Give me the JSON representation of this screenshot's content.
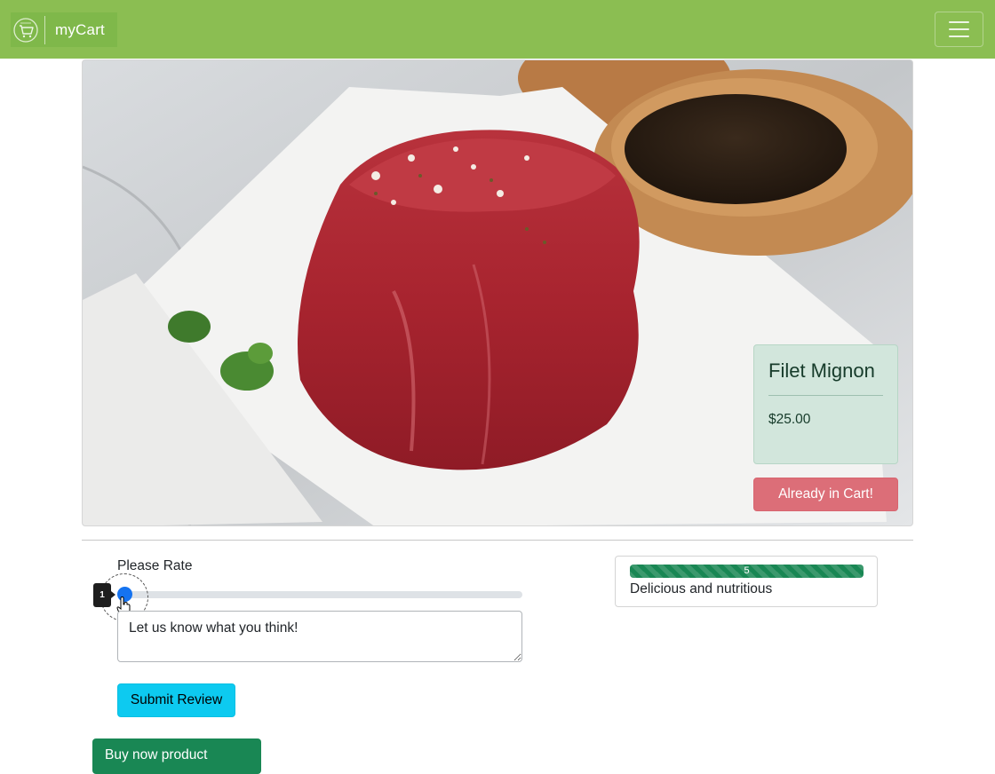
{
  "navbar": {
    "brand_name": "myCart",
    "brand_color": "#8bbe52",
    "logo_icon": "shopping-cart-icon",
    "menu_icon": "hamburger-menu-icon"
  },
  "product": {
    "name": "Filet Mignon",
    "price": "$25.00",
    "cart_button_label": "Already in Cart!",
    "image_subject": "raw filet mignon steak on white paper with peppercorns and herbs"
  },
  "review_form": {
    "rate_label": "Please Rate",
    "rating_value": "1",
    "rating_min": 1,
    "rating_max": 5,
    "comment_placeholder": "Let us know what you think!",
    "submit_label": "Submit Review",
    "secondary_button_label": "Buy now product"
  },
  "reviews": [
    {
      "rating": 5,
      "rating_label": "5",
      "rating_fraction": 1.0,
      "text": "Delicious and nutritious"
    }
  ],
  "colors": {
    "cart_button": "#dc6e78",
    "submit_button": "#0dcaf0",
    "progress": "#198754",
    "slider_thumb": "#1573f0"
  }
}
